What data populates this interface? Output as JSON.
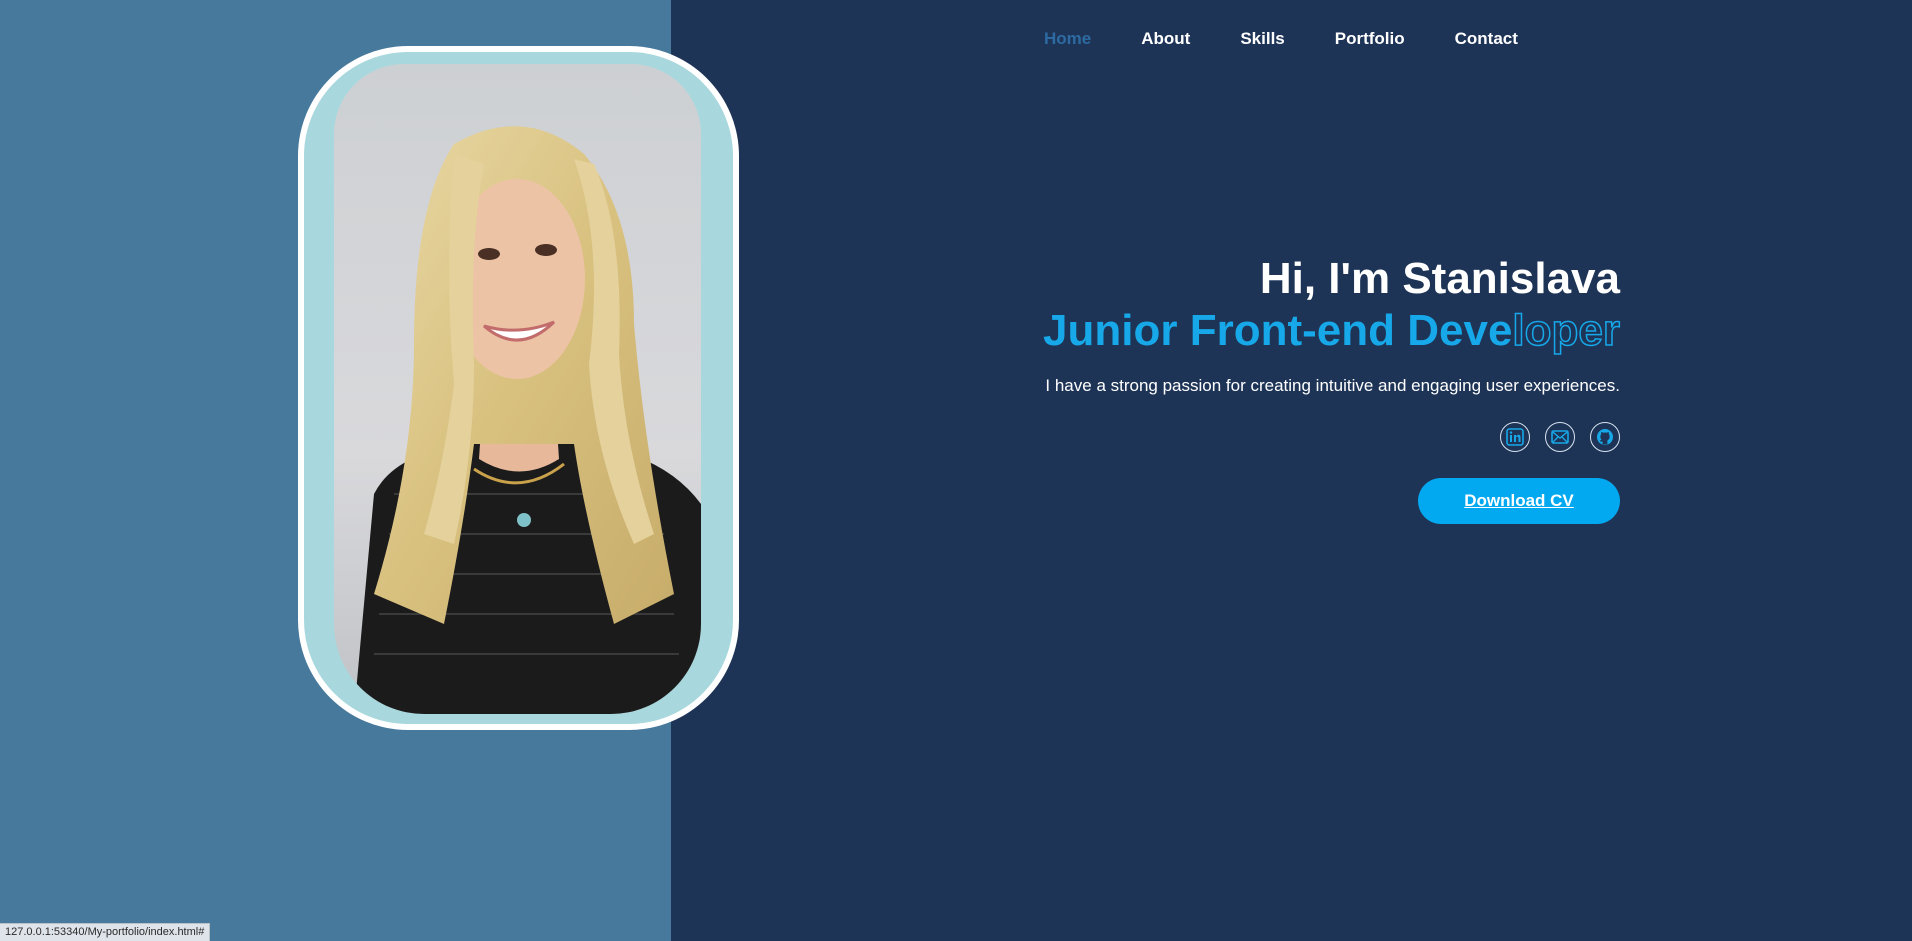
{
  "nav": {
    "items": [
      {
        "label": "Home",
        "active": true
      },
      {
        "label": "About"
      },
      {
        "label": "Skills"
      },
      {
        "label": "Portfolio"
      },
      {
        "label": "Contact"
      }
    ]
  },
  "hero": {
    "greeting": "Hi, I'm Stanislava",
    "role_solid": "Junior Front-end Deve",
    "role_outline": "loper",
    "tagline": "I have a strong passion for creating intuitive and engaging user experiences.",
    "download_label": "Download CV"
  },
  "socials": [
    {
      "icon": "linkedin-icon"
    },
    {
      "icon": "mail-icon"
    },
    {
      "icon": "github-icon"
    }
  ],
  "status_bar": {
    "url": "127.0.0.1:53340/My-portfolio/index.html#"
  },
  "colors": {
    "background": "#1e3457",
    "left_panel": "#46799b",
    "accent": "#16a8e8",
    "button": "#03a9f0",
    "nav_active": "#2d6aa1",
    "frame_inner": "#a8d8dd"
  }
}
